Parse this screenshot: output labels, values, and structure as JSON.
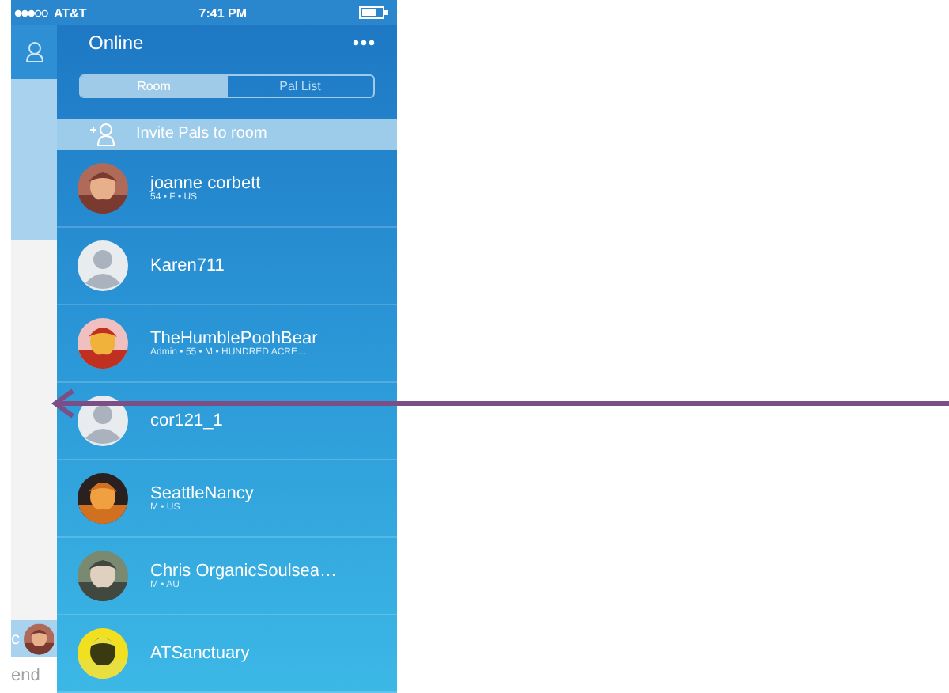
{
  "status_bar": {
    "carrier": "AT&T",
    "time": "7:41 PM"
  },
  "side_strip": {
    "message_fragment": "c",
    "send_fragment": "end"
  },
  "header": {
    "title": "Online"
  },
  "segments": [
    {
      "label": "Room",
      "selected": true
    },
    {
      "label": "Pal List",
      "selected": false
    }
  ],
  "invite": {
    "label": "Invite Pals to room"
  },
  "users": [
    {
      "name": "joanne corbett",
      "details": "54 • F • US"
    },
    {
      "name": "Karen711",
      "kind": "default"
    },
    {
      "name": "TheHumblePoohBear",
      "details": "Admin • 55 • M • HUNDRED ACRE…"
    },
    {
      "name": "cor121_1",
      "kind": "default"
    },
    {
      "name": "SeattleNancy",
      "details": "M • US"
    },
    {
      "name": "Chris OrganicSoulsea…",
      "details": "M • AU"
    },
    {
      "name": "ATSanctuary"
    }
  ]
}
